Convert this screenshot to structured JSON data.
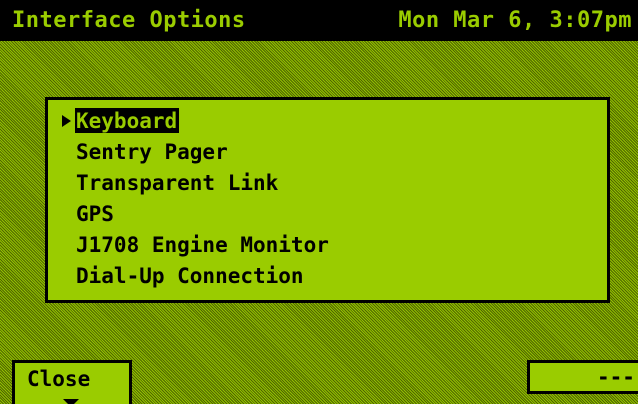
{
  "header": {
    "title": "Interface Options",
    "datetime": "Mon Mar 6, 3:07pm"
  },
  "menu": {
    "selected_index": 0,
    "items": [
      {
        "label": "Keyboard"
      },
      {
        "label": "Sentry Pager"
      },
      {
        "label": "Transparent Link"
      },
      {
        "label": "GPS"
      },
      {
        "label": "J1708 Engine Monitor"
      },
      {
        "label": "Dial-Up Connection"
      }
    ]
  },
  "softkeys": {
    "left_label": "Close",
    "right_label": "---"
  },
  "colors": {
    "lcd_green": "#9acc00",
    "ink": "#000000",
    "dither_dark": "#4e6500",
    "dither_light": "#93c000"
  }
}
